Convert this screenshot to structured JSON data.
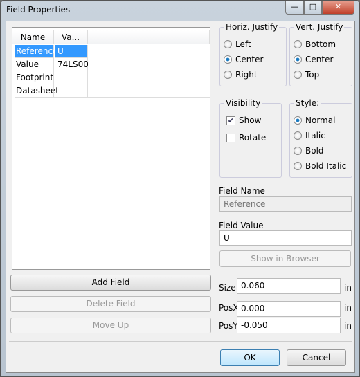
{
  "window": {
    "title": "Field Properties",
    "minimize": "—",
    "maximize": "□",
    "close": "✕"
  },
  "fields_table": {
    "columns": [
      "Name",
      "Va..."
    ],
    "rows": [
      {
        "name": "Reference",
        "value": "U",
        "selected": true
      },
      {
        "name": "Value",
        "value": "74LS00"
      },
      {
        "name": "Footprint",
        "value": ""
      },
      {
        "name": "Datasheet",
        "value": ""
      }
    ]
  },
  "buttons": {
    "add_field": "Add Field",
    "delete_field": "Delete Field",
    "move_up": "Move Up",
    "show_in_browser": "Show in Browser",
    "ok": "OK",
    "cancel": "Cancel"
  },
  "horiz_justify": {
    "label": "Horiz. Justify",
    "options": [
      "Left",
      "Center",
      "Right"
    ],
    "selected": "Center"
  },
  "vert_justify": {
    "label": "Vert. Justify",
    "options": [
      "Bottom",
      "Center",
      "Top"
    ],
    "selected": "Center"
  },
  "visibility": {
    "label": "Visibility",
    "show": "Show",
    "show_checked": true,
    "rotate": "Rotate",
    "rotate_checked": false
  },
  "style": {
    "label": "Style:",
    "options": [
      "Normal",
      "Italic",
      "Bold",
      "Bold Italic"
    ],
    "selected": "Normal"
  },
  "field_name": {
    "label": "Field Name",
    "value": "Reference"
  },
  "field_value": {
    "label": "Field Value",
    "value": "U"
  },
  "size": {
    "label": "Size",
    "value": "0.060",
    "unit": "in"
  },
  "posx": {
    "label": "PosX",
    "value": "0.000",
    "unit": "in"
  },
  "posy": {
    "label": "PosY",
    "value": "-0.050",
    "unit": "in"
  }
}
